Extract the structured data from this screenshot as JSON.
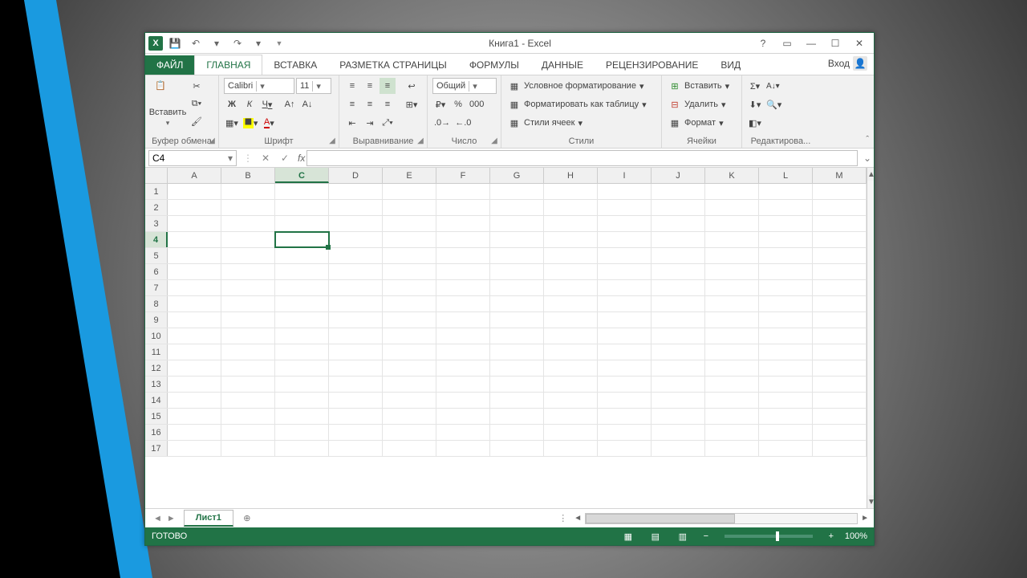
{
  "title": "Книга1 - Excel",
  "qat": {
    "undo": "↶",
    "redo": "↷"
  },
  "signin": "Вход",
  "tabs": {
    "file": "ФАЙЛ",
    "items": [
      "ГЛАВНАЯ",
      "ВСТАВКА",
      "РАЗМЕТКА СТРАНИЦЫ",
      "ФОРМУЛЫ",
      "ДАННЫЕ",
      "РЕЦЕНЗИРОВАНИЕ",
      "ВИД"
    ],
    "active": 0
  },
  "ribbon": {
    "clipboard": {
      "paste": "Вставить",
      "label": "Буфер обмена"
    },
    "font": {
      "name": "Calibri",
      "size": "11",
      "bold": "Ж",
      "italic": "К",
      "underline": "Ч",
      "label": "Шрифт"
    },
    "align": {
      "label": "Выравнивание"
    },
    "number": {
      "format": "Общий",
      "label": "Число"
    },
    "styles": {
      "cond": "Условное форматирование",
      "table": "Форматировать как таблицу",
      "cell": "Стили ячеек",
      "label": "Стили"
    },
    "cells": {
      "insert": "Вставить",
      "delete": "Удалить",
      "format": "Формат",
      "label": "Ячейки"
    },
    "editing": {
      "label": "Редактирова..."
    }
  },
  "namebox": "C4",
  "columns": [
    "A",
    "B",
    "C",
    "D",
    "E",
    "F",
    "G",
    "H",
    "I",
    "J",
    "K",
    "L",
    "M"
  ],
  "rows": [
    1,
    2,
    3,
    4,
    5,
    6,
    7,
    8,
    9,
    10,
    11,
    12,
    13,
    14,
    15,
    16,
    17
  ],
  "active_cell": {
    "col": "C",
    "row": 4
  },
  "sheet": {
    "tab": "Лист1"
  },
  "status": {
    "ready": "ГОТОВО",
    "zoom": "100%"
  }
}
